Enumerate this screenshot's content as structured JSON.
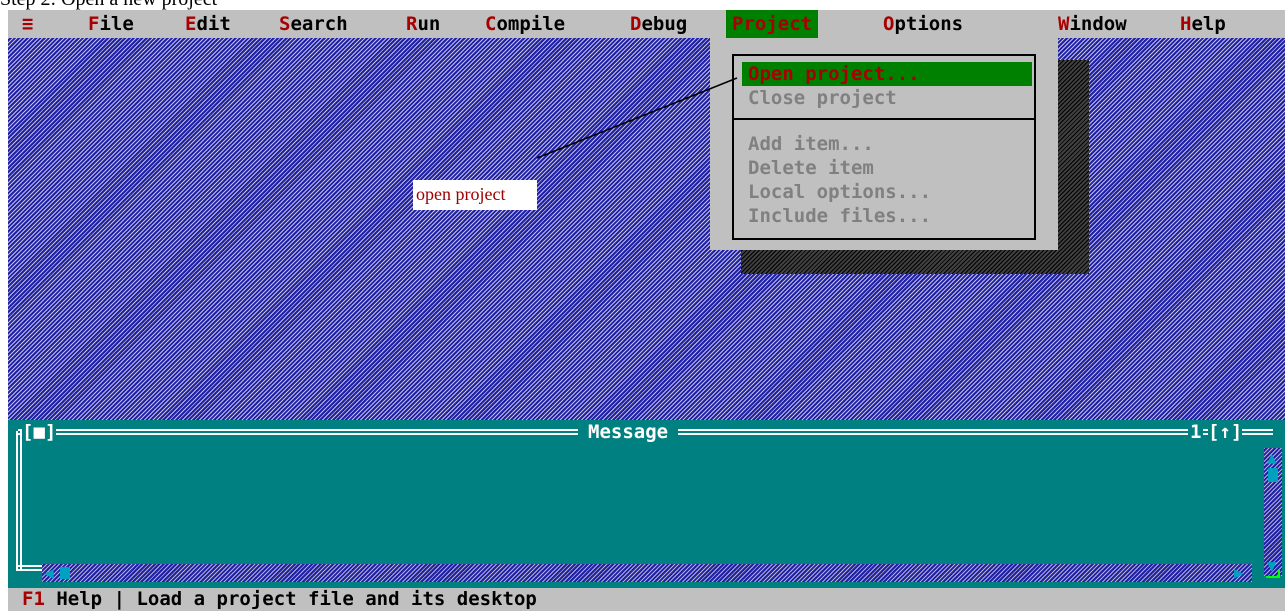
{
  "caption": "Step 2: Open a new project",
  "menubar": {
    "system_menu": "≡",
    "items": [
      {
        "hot": "F",
        "rest": "ile"
      },
      {
        "hot": "E",
        "rest": "dit"
      },
      {
        "hot": "S",
        "rest": "earch"
      },
      {
        "hot": "R",
        "rest": "un"
      },
      {
        "hot": "C",
        "rest": "ompile"
      },
      {
        "hot": "D",
        "rest": "ebug"
      },
      {
        "hot": "P",
        "rest": "roject"
      },
      {
        "hot": "O",
        "rest": "ptions"
      },
      {
        "hot": "W",
        "rest": "indow"
      },
      {
        "hot": "H",
        "rest": "elp"
      }
    ],
    "active_index": 6
  },
  "project_menu": {
    "items": [
      {
        "label": "Open project...",
        "enabled": true,
        "selected": true
      },
      {
        "label": "Close project",
        "enabled": false
      },
      {
        "label": "Add item...",
        "enabled": false
      },
      {
        "label": "Delete item",
        "enabled": false
      },
      {
        "label": "Local options...",
        "enabled": false
      },
      {
        "label": "Include files...",
        "enabled": false
      }
    ]
  },
  "annotation": {
    "label": "open project"
  },
  "message_window": {
    "title": "Message",
    "close_box": "[■]",
    "window_number": "1",
    "zoom_box": "[↑]"
  },
  "statusbar": {
    "key": "F1",
    "key_label": "Help",
    "separator": "|",
    "hint": "Load a project file and its desktop"
  },
  "colors": {
    "menu_bg": "#c0c0c0",
    "hotkey": "#a80000",
    "highlight": "#008000",
    "desktop": "#2020a8",
    "message_bg": "#008080"
  }
}
